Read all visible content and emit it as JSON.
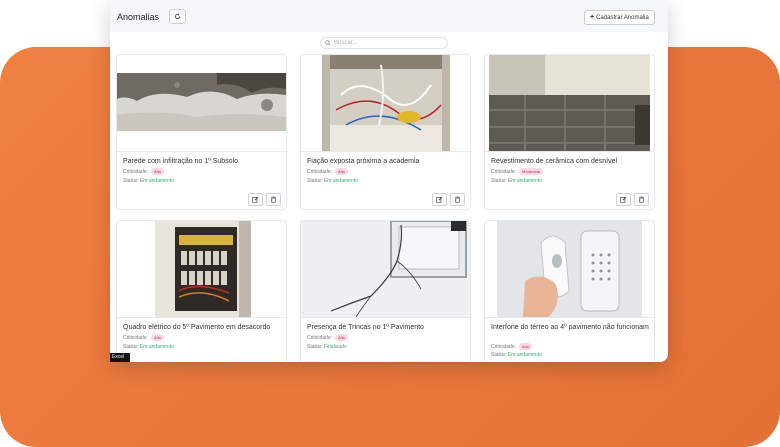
{
  "header": {
    "title": "Anomalias",
    "add_button_label": "Cadastrar Anomalia"
  },
  "search": {
    "placeholder": "Buscar..."
  },
  "labels": {
    "criticality": "Criticidade:",
    "status": "Status:"
  },
  "cards": [
    {
      "title": "Parede com infiltração no 1º Subsolo",
      "criticality": "Alta",
      "status": "Em andamento"
    },
    {
      "title": "Fiação exposta próxima a academia",
      "criticality": "Alta",
      "status": "Em andamento"
    },
    {
      "title": "Revestimento de cerâmica com desnível",
      "criticality": "Moderada",
      "status": "Em andamento"
    },
    {
      "title": "Quadro elétrico do 5º Pavimento em desacordo",
      "criticality": "Alta",
      "status": "Em andamento"
    },
    {
      "title": "Presença de Trincas no 1º Pavimento",
      "criticality": "Alta",
      "status": "Finalizado"
    },
    {
      "title": "Interfone do térreo ao 4º pavimento não funcionam",
      "criticality": "Alta",
      "status": "Em andamento"
    }
  ],
  "tooltip": "Excel",
  "colors": {
    "background": "#e9763a",
    "criticality_badge": "#f7d9e0",
    "status_text": "#33b06a"
  }
}
